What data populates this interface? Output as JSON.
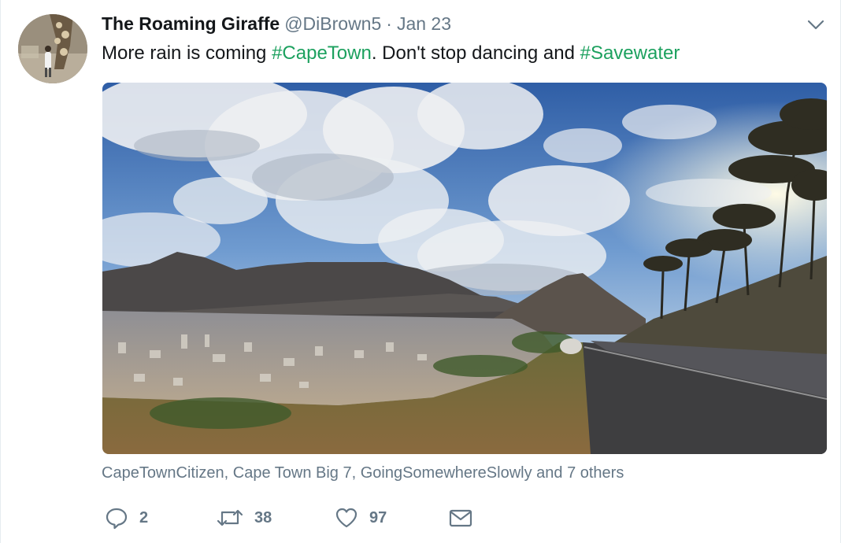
{
  "tweet": {
    "display_name": "The Roaming Giraffe",
    "handle": "@DiBrown5",
    "separator": "·",
    "date": "Jan 23",
    "text_parts": {
      "part1": "More rain is coming ",
      "hashtag1": "#CapeTown",
      "part2": ". Don't stop dancing and ",
      "hashtag2": "#Savewater"
    },
    "tagged_people": "CapeTownCitizen, Cape Town Big 7, GoingSomewhereSlowly and 7 others"
  },
  "actions": {
    "reply_count": "2",
    "retweet_count": "38",
    "like_count": "97"
  },
  "colors": {
    "hashtag": "#1da15f",
    "secondary_text": "#657786",
    "primary_text": "#14171a"
  },
  "icons": [
    "chevron-down-icon",
    "reply-icon",
    "retweet-icon",
    "heart-icon",
    "envelope-icon"
  ]
}
